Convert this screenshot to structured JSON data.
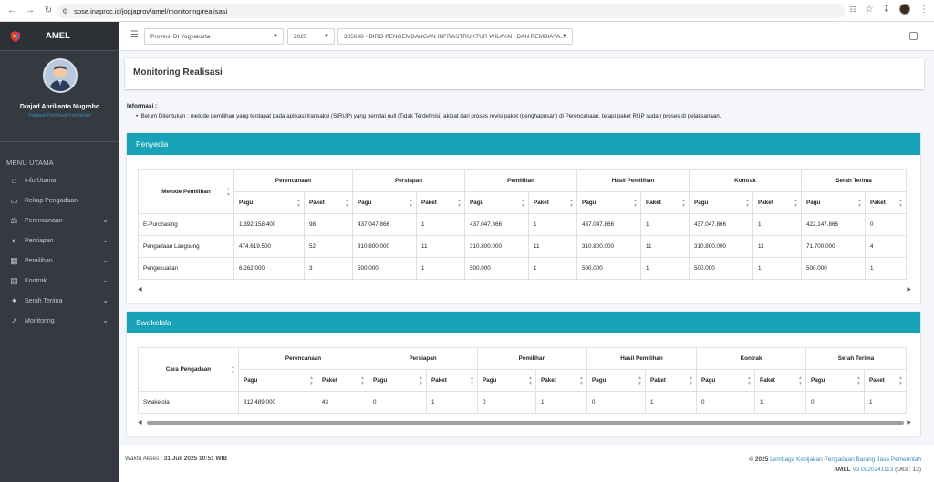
{
  "browser": {
    "url": "spse.inaproc.id/jogjaprov/amel/monitoring/realisasi"
  },
  "sidebar": {
    "brand": "AMEL",
    "user_name": "Drajad Aprilianto Nugroho",
    "user_role": "Pejabat Pembuat Komitmen",
    "menu_header": "MENU UTAMA",
    "items": [
      {
        "label": "Info Utama",
        "icon": "home-icon",
        "has_chevron": false
      },
      {
        "label": "Rekap Pengadaan",
        "icon": "laptop-icon",
        "has_chevron": false
      },
      {
        "label": "Perencanaan",
        "icon": "balance-scale-icon",
        "has_chevron": true
      },
      {
        "label": "Persiapan",
        "icon": "adjust-icon",
        "has_chevron": true
      },
      {
        "label": "Pemilihan",
        "icon": "calendar-icon",
        "has_chevron": true
      },
      {
        "label": "Kontrak",
        "icon": "file-icon",
        "has_chevron": true
      },
      {
        "label": "Serah Terima",
        "icon": "handshake-icon",
        "has_chevron": true
      },
      {
        "label": "Monitoring",
        "icon": "line-chart-icon",
        "has_chevron": true
      }
    ]
  },
  "topnav": {
    "provinsi": "Provinsi DI Yogyakarta",
    "tahun": "2025",
    "satker": "305698 - BIRO PENGEMBANGAN INFRASTRUKTUR WILAYAH DAN PEMBIAYA..."
  },
  "page": {
    "title": "Monitoring Realisasi",
    "info_title": "Informasi :",
    "info_text": "Belum Ditentukan : metode pemilihan yang terdapat pada aplikasi transaksi (SIRUP) yang bernilai null (Tidak Terdefinisi) akibat dari proses revisi paket (penghapusan) di Perencanaan, tetapi paket RUP sudah proses di pelaksanaan."
  },
  "penyedia": {
    "header": "Penyedia",
    "first_col": "Metode Pemilihan",
    "groups": [
      "Perencanaan",
      "Persiapan",
      "Pemilihan",
      "Hasil Pemilihan",
      "Kontrak",
      "Serah Terima"
    ],
    "sub_pagu": "Pagu",
    "sub_paket": "Paket",
    "rows": [
      {
        "name": "E-Purchasing",
        "values": [
          "1.392.158.400",
          "98",
          "437.047.866",
          "1",
          "437.047.866",
          "1",
          "437.047.866",
          "1",
          "437.047.866",
          "1",
          "422.147.866",
          "0"
        ]
      },
      {
        "name": "Pengadaan Langsung",
        "values": [
          "474.619.500",
          "52",
          "310.800.000",
          "11",
          "310.800.000",
          "11",
          "310.800.000",
          "11",
          "310.800.000",
          "11",
          "71.700.000",
          "4"
        ]
      },
      {
        "name": "Pengecualian",
        "values": [
          "6.262.000",
          "3",
          "500.000",
          "1",
          "500.000",
          "1",
          "500.000",
          "1",
          "500.000",
          "1",
          "500.000",
          "1"
        ]
      }
    ]
  },
  "swakelola": {
    "header": "Swakelola",
    "first_col": "Cara Pengadaan",
    "groups": [
      "Perencanaan",
      "Persiapan",
      "Pemilihan",
      "Hasil Pemilihan",
      "Kontrak",
      "Serah Terima"
    ],
    "sub_pagu": "Pagu",
    "sub_paket": "Paket",
    "rows": [
      {
        "name": "Swakelola",
        "values": [
          "812.489.000",
          "43",
          "0",
          "1",
          "0",
          "1",
          "0",
          "1",
          "0",
          "1",
          "0",
          "1"
        ]
      }
    ]
  },
  "footer": {
    "access_label": "Waktu Akses : ",
    "access_time": "31 Juli 2025 10:51 WIB",
    "copyright_prefix": "© 2025 ",
    "org_link": "Lembaga Kebijakan Pengadaan Barang Jasa Pemerintah",
    "app_name": "AMEL ",
    "version": "V3.0u20241113",
    "build": " (D63 : 13)"
  }
}
